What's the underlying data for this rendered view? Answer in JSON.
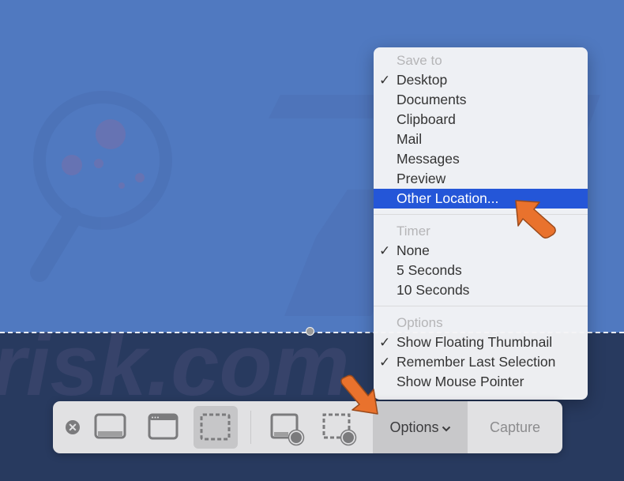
{
  "menu": {
    "sections": [
      {
        "header": "Save to",
        "items": [
          {
            "label": "Desktop",
            "checked": true
          },
          {
            "label": "Documents",
            "checked": false
          },
          {
            "label": "Clipboard",
            "checked": false
          },
          {
            "label": "Mail",
            "checked": false
          },
          {
            "label": "Messages",
            "checked": false
          },
          {
            "label": "Preview",
            "checked": false
          },
          {
            "label": "Other Location...",
            "checked": false,
            "highlighted": true
          }
        ]
      },
      {
        "header": "Timer",
        "items": [
          {
            "label": "None",
            "checked": true
          },
          {
            "label": "5 Seconds",
            "checked": false
          },
          {
            "label": "10 Seconds",
            "checked": false
          }
        ]
      },
      {
        "header": "Options",
        "items": [
          {
            "label": "Show Floating Thumbnail",
            "checked": true
          },
          {
            "label": "Remember Last Selection",
            "checked": true
          },
          {
            "label": "Show Mouse Pointer",
            "checked": false
          }
        ]
      }
    ],
    "check_glyph": "✓"
  },
  "toolbar": {
    "close_glyph": "✕",
    "buttons": [
      {
        "name": "capture-entire-screen",
        "icon": "screen-icon"
      },
      {
        "name": "capture-selected-window",
        "icon": "window-icon"
      },
      {
        "name": "capture-selected-portion",
        "icon": "selection-icon",
        "active": true
      },
      {
        "name": "record-entire-screen",
        "icon": "screen-record-icon"
      },
      {
        "name": "record-selected-portion",
        "icon": "selection-record-icon"
      }
    ],
    "options_label": "Options",
    "options_chevron": "⌄",
    "capture_label": "Capture"
  },
  "colors": {
    "highlight": "#2456d8",
    "annotation_arrow": "#e9722d",
    "backdrop_top": "#5079c0",
    "backdrop_bottom": "#283a5f"
  }
}
